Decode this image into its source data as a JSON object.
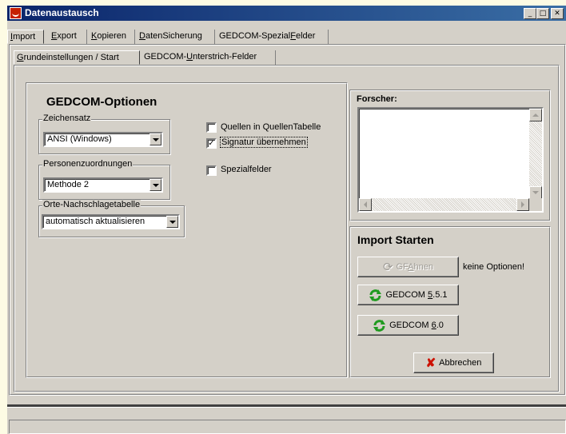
{
  "window": {
    "title": "Datenaustausch",
    "controls": {
      "minimize": "_",
      "maximize": "□",
      "close": "✕"
    }
  },
  "tabs": [
    {
      "pre": "",
      "u": "I",
      "post": "mport"
    },
    {
      "pre": "",
      "u": "E",
      "post": "xport"
    },
    {
      "pre": "",
      "u": "K",
      "post": "opieren"
    },
    {
      "pre": "",
      "u": "D",
      "post": "atenSicherung"
    },
    {
      "pre": "GEDCOM-Spezial",
      "u": "F",
      "post": "elder"
    }
  ],
  "subtabs": [
    {
      "pre": "",
      "u": "G",
      "post": "rundeinstellungen / Start"
    },
    {
      "pre": "GEDCOM-",
      "u": "U",
      "post": "nterstrich-Felder"
    }
  ],
  "gedcom": {
    "heading": "GEDCOM-Optionen",
    "zeichensatz": {
      "label": "Zeichensatz",
      "value": "ANSI (Windows)"
    },
    "personen": {
      "label": "Personenzuordnungen",
      "value": "Methode 2"
    },
    "orte": {
      "label": "Orte-Nachschlagetabelle",
      "value": "automatisch aktualisieren"
    },
    "checkboxes": [
      {
        "label": "Quellen in QuellenTabelle",
        "checked": false
      },
      {
        "label": "Signatur übernehmen",
        "checked": true
      },
      {
        "label": "Spezialfelder",
        "checked": false
      }
    ]
  },
  "forscher": {
    "label": "Forscher:"
  },
  "import": {
    "heading": "Import Starten",
    "gfahnen": {
      "pre": "GF",
      "u": "A",
      "post": "hnen"
    },
    "gfahnen_note": "keine Optionen!",
    "gedcom551": {
      "pre": "GEDCOM ",
      "u": "5",
      "post": ".5.1"
    },
    "gedcom60": {
      "pre": "GEDCOM ",
      "u": "6",
      "post": ".0"
    },
    "abbrechen": "Abbrechen"
  },
  "colors": {
    "accent": "#0a246a",
    "refresh_green": "#1f9a1f",
    "cancel_red": "#cc1100"
  }
}
